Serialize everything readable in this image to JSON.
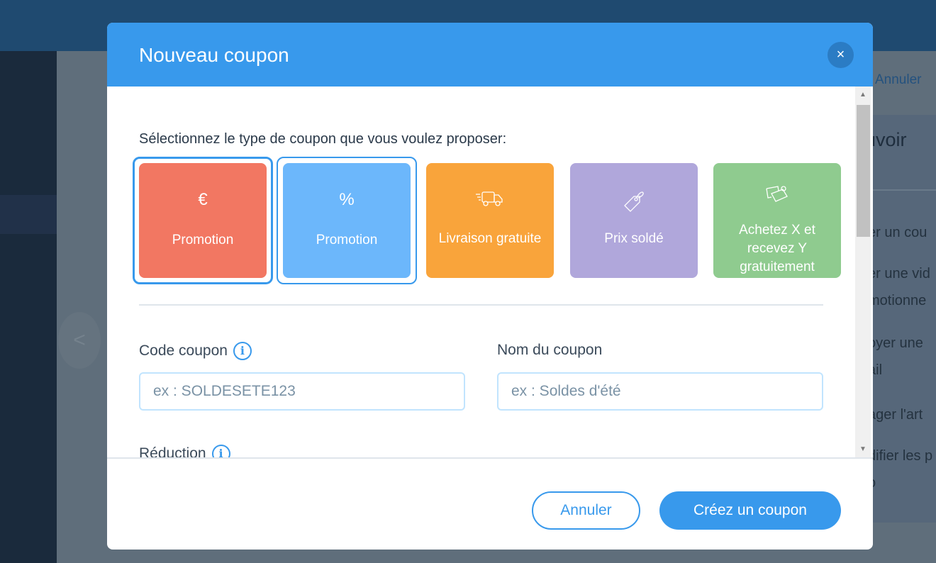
{
  "background": {
    "cancel_label": "Annuler",
    "title_fragment": "uvoir",
    "items": [
      "er un cou",
      "er une vid\nmotionne",
      "oyer une\nail",
      "ager l'art",
      "difier les p\no"
    ],
    "arrow": "<"
  },
  "modal": {
    "title": "Nouveau coupon",
    "close_icon": "×",
    "prompt": "Sélectionnez le type de coupon que vous voulez proposer:",
    "cards": [
      {
        "icon": "euro-icon",
        "glyph": "€",
        "label": "Promotion",
        "color": "#f27762",
        "selected": true
      },
      {
        "icon": "percent-icon",
        "glyph": "%",
        "label": "Promotion",
        "color": "#6cb7fb",
        "selected": false
      },
      {
        "icon": "truck-icon",
        "label": "Livraison gratuite",
        "color": "#f9a43b"
      },
      {
        "icon": "tag-icon",
        "label": "Prix soldé",
        "color": "#b0a7db"
      },
      {
        "icon": "tags-icon",
        "label": "Achetez X et recevez Y gratuitement",
        "color": "#8fcb8f"
      }
    ],
    "code_label": "Code coupon",
    "code_placeholder": "ex : SOLDESETE123",
    "name_label": "Nom du coupon",
    "name_placeholder": "ex : Soldes d'été",
    "reduction_label": "Réduction",
    "info_glyph": "i",
    "cancel_label": "Annuler",
    "create_label": "Créez un coupon"
  }
}
